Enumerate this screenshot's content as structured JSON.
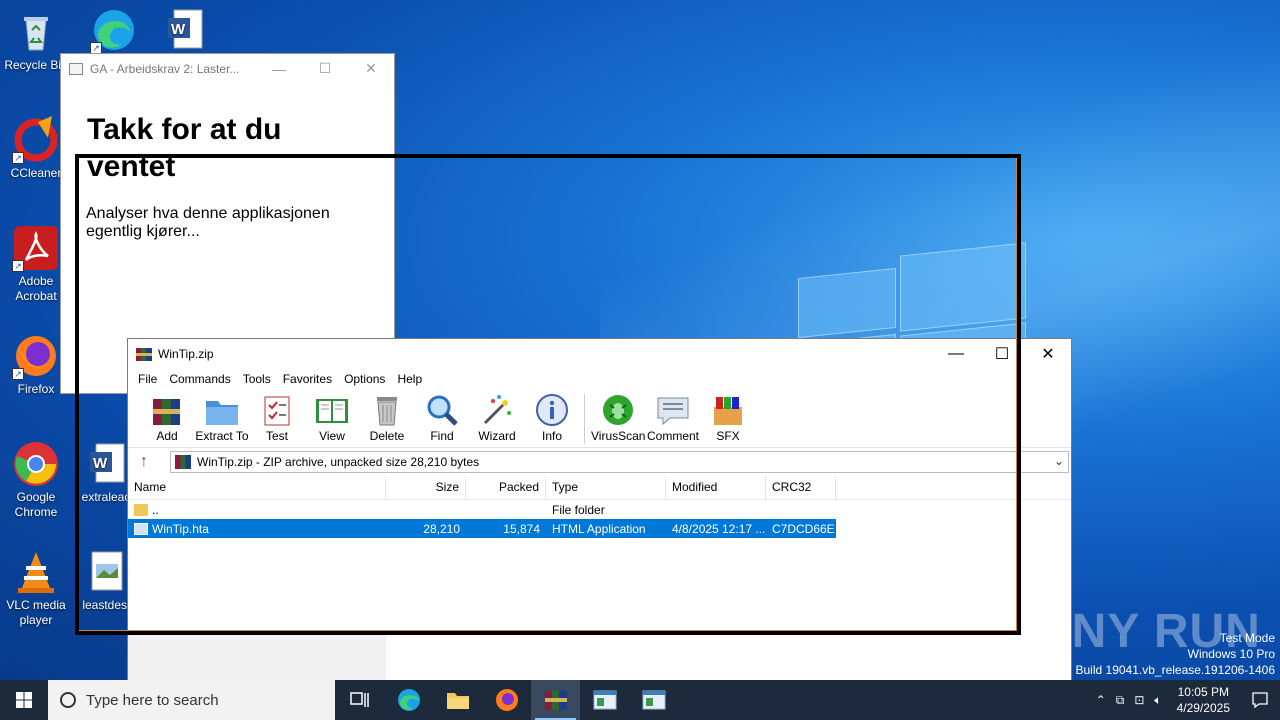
{
  "desktop_icons": [
    {
      "label": "Recycle Bin",
      "icon": "recycle-bin-icon"
    },
    {
      "label": "CCleaner",
      "icon": "ccleaner-icon"
    },
    {
      "label": "Adobe Acrobat",
      "icon": "adobe-acrobat-icon"
    },
    {
      "label": "Firefox",
      "icon": "firefox-icon"
    },
    {
      "label": "Google Chrome",
      "icon": "chrome-icon"
    },
    {
      "label": "VLC media player",
      "icon": "vlc-icon"
    },
    {
      "label": "extraleac",
      "icon": "word-document-icon"
    },
    {
      "label": "leastdesi",
      "icon": "image-file-icon"
    }
  ],
  "hta_window": {
    "title": "GA - Arbeidskrav 2: Laster...",
    "heading": "Takk for at du ventet",
    "body": "Analyser hva denne applikasjonen egentlig kjører..."
  },
  "winrar": {
    "title": "WinTip.zip",
    "menu": [
      "File",
      "Commands",
      "Tools",
      "Favorites",
      "Options",
      "Help"
    ],
    "toolbar": [
      "Add",
      "Extract To",
      "Test",
      "View",
      "Delete",
      "Find",
      "Wizard",
      "Info",
      "VirusScan",
      "Comment",
      "SFX"
    ],
    "address": "WinTip.zip - ZIP archive, unpacked size 28,210 bytes",
    "columns": [
      "Name",
      "Size",
      "Packed",
      "Type",
      "Modified",
      "CRC32"
    ],
    "rows": [
      {
        "name": "..",
        "size": "",
        "packed": "",
        "type": "File folder",
        "modified": "",
        "crc": ""
      },
      {
        "name": "WinTip.hta",
        "size": "28,210",
        "packed": "15,874",
        "type": "HTML Application",
        "modified": "4/8/2025 12:17 ...",
        "crc": "C7DCD66E"
      }
    ]
  },
  "watermark": {
    "brand": "ANY RUN",
    "line1": "Test Mode",
    "line2": "Windows 10 Pro",
    "line3": "Build 19041.vb_release.191206-1406"
  },
  "taskbar": {
    "search_placeholder": "Type here to search",
    "time": "10:05 PM",
    "date": "4/29/2025"
  },
  "colors": {
    "accent": "#0078d7",
    "highlight_orange": "#c8834a"
  }
}
